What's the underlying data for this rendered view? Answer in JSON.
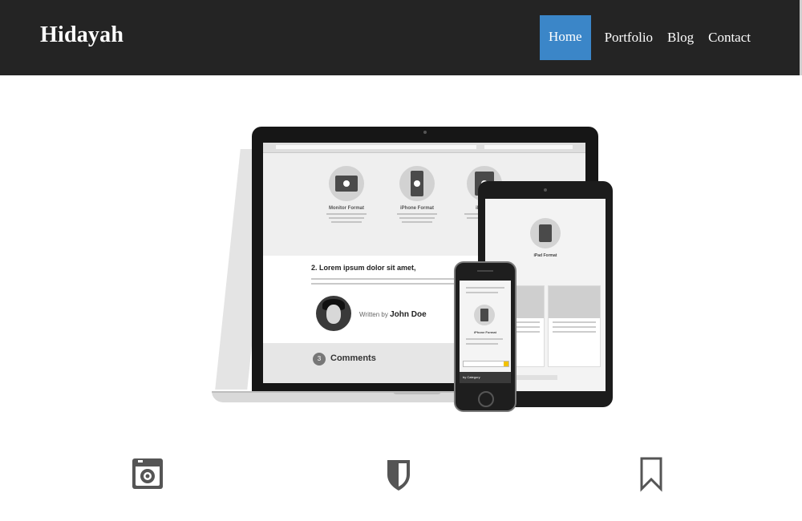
{
  "navbar": {
    "brand": "Hidayah",
    "items": [
      {
        "label": "Home",
        "active": true
      },
      {
        "label": "Portfolio",
        "active": false
      },
      {
        "label": "Blog",
        "active": false
      },
      {
        "label": "Contact",
        "active": false
      }
    ]
  },
  "hero": {
    "image": "responsive-devices-mockup",
    "laptop_screen": {
      "formats": [
        "Monitor Format",
        "iPhone Format",
        "iPad Fo"
      ],
      "post_heading": "2. Lorem ipsum dolor sit amet,",
      "written_by": "Written by",
      "author": "John Doe",
      "comments_count": "3",
      "comments_label": "Comments"
    },
    "tablet_screen": {
      "title": "iPad Format"
    },
    "phone_screen": {
      "title": "iPhone Format",
      "category": "by Category"
    }
  },
  "features": [
    {
      "icon": "camera-icon"
    },
    {
      "icon": "shield-icon"
    },
    {
      "icon": "bookmark-icon"
    }
  ],
  "colors": {
    "navbar_bg": "#242424",
    "active_nav_bg": "#3b86c8",
    "icon_gray": "#555555"
  }
}
